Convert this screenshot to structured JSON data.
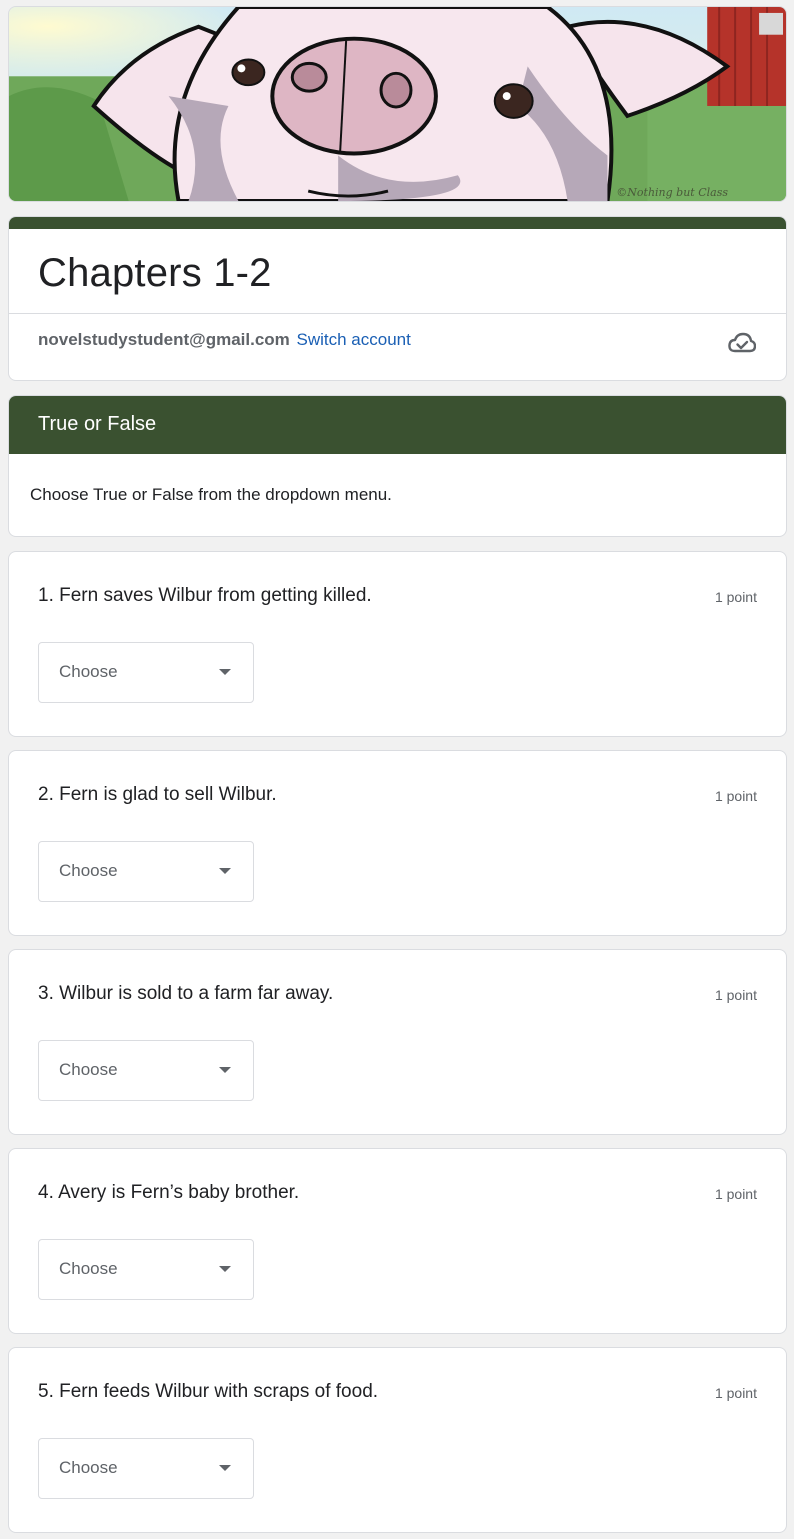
{
  "banner": {
    "credit": "©Nothing but Class"
  },
  "form": {
    "title": "Chapters 1-2",
    "account_email": "novelstudystudent@gmail.com",
    "switch_account_label": "Switch account",
    "icons": {
      "save_status": "cloud-check-icon"
    }
  },
  "section": {
    "title": "True or False",
    "description": "Choose True or False from the dropdown menu."
  },
  "questions": [
    {
      "text": "1. Fern saves Wilbur from getting killed.",
      "points": "1 point",
      "select_value": "Choose"
    },
    {
      "text": "2. Fern is glad to sell Wilbur.",
      "points": "1 point",
      "select_value": "Choose"
    },
    {
      "text": "3. Wilbur is sold to a farm far away.",
      "points": "1 point",
      "select_value": "Choose"
    },
    {
      "text": "4. Avery is Fern’s baby brother.",
      "points": "1 point",
      "select_value": "Choose"
    },
    {
      "text": "5. Fern feeds Wilbur with scraps of food.",
      "points": "1 point",
      "select_value": "Choose"
    }
  ],
  "colors": {
    "theme": "#3a5130",
    "link": "#1a5fb4",
    "background": "#f1f1f1"
  }
}
